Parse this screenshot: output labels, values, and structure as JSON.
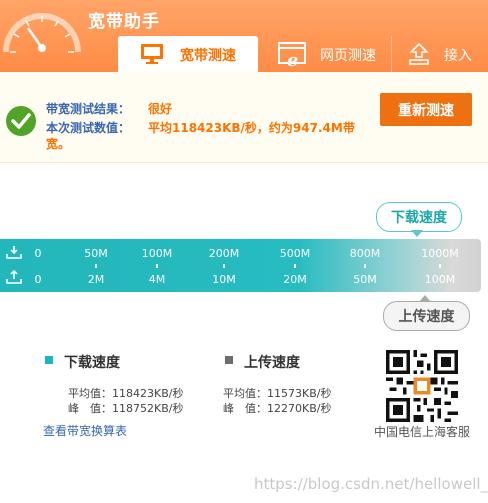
{
  "app": {
    "title": "宽带助手"
  },
  "tabs": [
    {
      "label": "宽带测速",
      "icon": "monitor-icon",
      "active": true
    },
    {
      "label": "网页测速",
      "icon": "ie-browser-icon",
      "active": false
    },
    {
      "label": "接入",
      "icon": "network-icon",
      "active": false
    }
  ],
  "result": {
    "line1_label": "带宽测试结果：",
    "line1_value": "很好",
    "line2_label": "本次测试数值：",
    "line2_value": "平均118423KB/秒，约为947.4M带",
    "line2_value_wrap": "宽。",
    "retest_label": "重新测速"
  },
  "speed": {
    "download_bubble": "下载速度",
    "upload_bubble": "上传速度",
    "download_scale": [
      "0",
      "50M",
      "100M",
      "200M",
      "500M",
      "800M",
      "1000M"
    ],
    "upload_scale": [
      "0",
      "2M",
      "4M",
      "10M",
      "20M",
      "50M",
      "100M"
    ]
  },
  "legend": {
    "download": {
      "title": "下载速度",
      "color": "#1ab8c4",
      "avg": "平均值：118423KB/秒",
      "peak": "峰　值：118752KB/秒"
    },
    "upload": {
      "title": "上传速度",
      "color": "#6e6e6e",
      "avg": "平均值：11573KB/秒",
      "peak": "峰　值：12270KB/秒"
    }
  },
  "link": "查看带宽换算表",
  "qr_caption": "中国电信上海客服",
  "watermark": "https://blog.csdn.net/hellowell_g"
}
